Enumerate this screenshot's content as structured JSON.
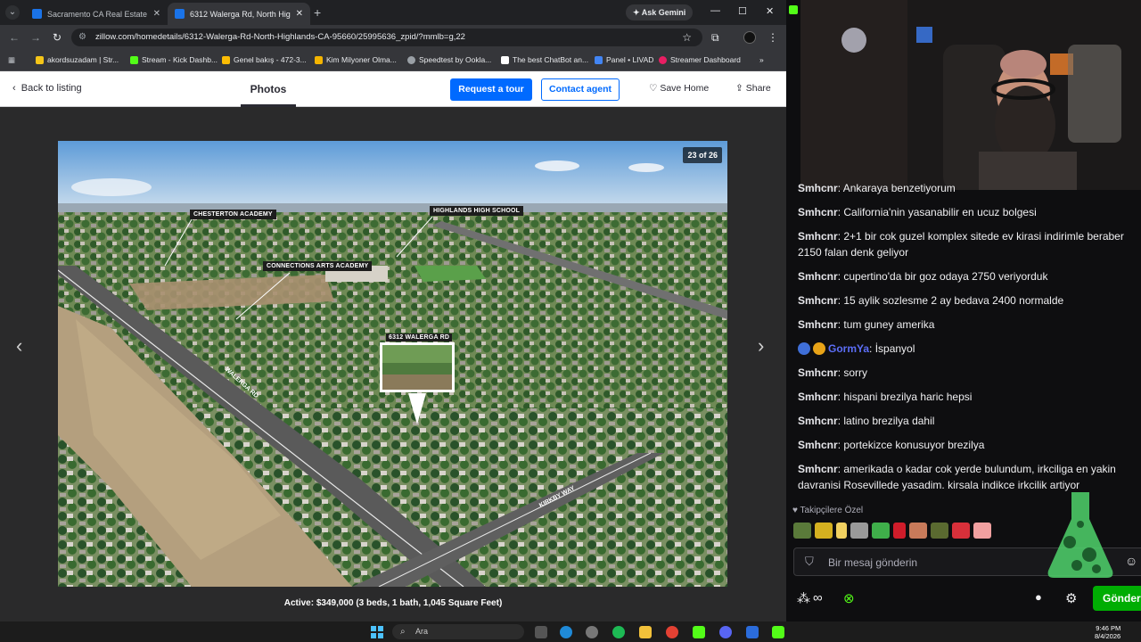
{
  "browser": {
    "tabs": [
      {
        "title": "Sacramento CA Real Estate - Se",
        "active": false
      },
      {
        "title": "6312 Walerga Rd, North Highlan",
        "active": true
      }
    ],
    "new_tab": "+",
    "gemini": "Ask Gemini",
    "window_controls": [
      "—",
      "☐",
      "✕"
    ],
    "url": "zillow.com/homedetails/6312-Walerga-Rd-North-Highlands-CA-95660/25995636_zpid/?mmlb=g,22",
    "bookmarks": [
      {
        "label": "akordsuzadam | Str...",
        "color": "#f5c518"
      },
      {
        "label": "Stream - Kick Dashb...",
        "color": "#53fc18"
      },
      {
        "label": "Genel bakış - 472-3...",
        "color": "#fbbc04"
      },
      {
        "label": "Kim Milyoner Olma...",
        "color": "#f4b400"
      },
      {
        "label": "Speedtest by Ookla...",
        "color": "#9aa0a6"
      },
      {
        "label": "The best ChatBot an...",
        "color": "#ffffff"
      },
      {
        "label": "Panel • LIVAD",
        "color": "#4285f4"
      },
      {
        "label": "Streamer Dashboard",
        "color": "#e91e63"
      }
    ],
    "bookmarks_more": "»"
  },
  "zillow": {
    "back": "Back to listing",
    "photos_tab": "Photos",
    "request_tour": "Request a tour",
    "contact_agent": "Contact agent",
    "save_home": "Save Home",
    "share": "Share",
    "counter": "23 of 26",
    "caption": "Active: $349,000 (3 beds, 1 bath, 1,045 Square Feet)",
    "labels": {
      "chesterton": "CHESTERTON ACADEMY",
      "highlands": "HIGHLANDS HIGH SCHOOL",
      "connections": "CONNECTIONS ARTS ACADEMY",
      "property": "6312 WALERGA RD",
      "walerga": "WALERGA RD",
      "kirkby": "KIRKBY WAY"
    }
  },
  "chat": {
    "messages": [
      {
        "user": "Smhcnr",
        "text": "Ankaraya benzetiyorum"
      },
      {
        "user": "Smhcnr",
        "text": "California'nin yasanabilir en ucuz bolgesi"
      },
      {
        "user": "Smhcnr",
        "text": "2+1 bir cok guzel komplex sitede ev kirasi indirimle beraber 2150 falan denk geliyor"
      },
      {
        "user": "Smhcnr",
        "text": "cupertino'da bir goz odaya 2750 veriyorduk"
      },
      {
        "user": "Smhcnr",
        "text": "15 aylik sozlesme 2 ay bedava 2400 normalde"
      },
      {
        "user": "Smhcnr",
        "text": "tum guney amerika"
      },
      {
        "user": "GormYa",
        "text": "İspanyol"
      },
      {
        "user": "Smhcnr",
        "text": "sorry"
      },
      {
        "user": "Smhcnr",
        "text": "hispani brezilya haric hepsi"
      },
      {
        "user": "Smhcnr",
        "text": "latino brezilya dahil"
      },
      {
        "user": "Smhcnr",
        "text": "portekizce konusuyor brezilya"
      },
      {
        "user": "Smhcnr",
        "text": "amerikada o kadar cok yerde bulundum, irkciliga en yakin davranisi Rosevillede yasadim. kirsala indikce irkcilik artiyor"
      }
    ],
    "followers_only": "Takipçilere Özel",
    "input_placeholder": "Bir mesaj gönderin",
    "send": "Gönder"
  },
  "taskbar": {
    "search": "Ara",
    "time": "9:46 PM",
    "date": "8/4/2026"
  }
}
